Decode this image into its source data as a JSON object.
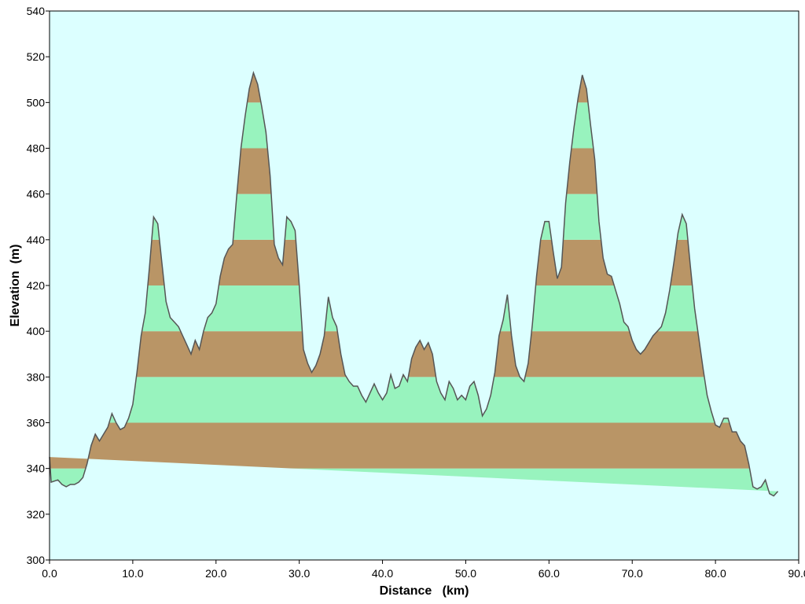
{
  "chart_data": {
    "type": "area",
    "xlabel": "Distance   (km)",
    "ylabel": "Elevation  (m)",
    "xlim": [
      0,
      90
    ],
    "ylim": [
      300,
      540
    ],
    "xticks": [
      0,
      10,
      20,
      30,
      40,
      50,
      60,
      70,
      80,
      90
    ],
    "xtick_labels": [
      "0.0",
      "10.0",
      "20.0",
      "30.0",
      "40.0",
      "50.0",
      "60.0",
      "70.0",
      "80.0",
      "90.0"
    ],
    "yticks": [
      300,
      320,
      340,
      360,
      380,
      400,
      420,
      440,
      460,
      480,
      500,
      520,
      540
    ],
    "ytick_labels": [
      "300",
      "320",
      "340",
      "360",
      "380",
      "400",
      "420",
      "440",
      "460",
      "480",
      "500",
      "520",
      "540"
    ],
    "band_interval": 20,
    "colors": {
      "background": "#dcffff",
      "band_brown": "#b99566",
      "band_green": "#98f3be",
      "profile_line": "#555555",
      "frame": "#000000"
    },
    "x": [
      0,
      0.2,
      1,
      1.5,
      2,
      2.5,
      3,
      3.5,
      4,
      4.5,
      5,
      5.5,
      6,
      6.5,
      7,
      7.5,
      8,
      8.5,
      9,
      9.5,
      10,
      10.5,
      11,
      11.5,
      12,
      12.5,
      13,
      13.5,
      14,
      14.5,
      15,
      15.5,
      16,
      16.5,
      17,
      17.5,
      18,
      18.5,
      19,
      19.5,
      20,
      20.5,
      21,
      21.5,
      22,
      22.5,
      23,
      23.5,
      24,
      24.5,
      25,
      25.5,
      26,
      26.5,
      27,
      27.5,
      28,
      28.5,
      29,
      29.5,
      30,
      30.5,
      31,
      31.5,
      32,
      32.5,
      33,
      33.5,
      34,
      34.5,
      35,
      35.5,
      36,
      36.5,
      37,
      37.5,
      38,
      38.5,
      39,
      39.5,
      40,
      40.5,
      41,
      41.5,
      42,
      42.5,
      43,
      43.5,
      44,
      44.5,
      45,
      45.5,
      46,
      46.5,
      47,
      47.5,
      48,
      48.5,
      49,
      49.5,
      50,
      50.5,
      51,
      51.5,
      52,
      52.5,
      53,
      53.5,
      54,
      54.5,
      55,
      55.5,
      56,
      56.5,
      57,
      57.5,
      58,
      58.5,
      59,
      59.5,
      60,
      60.5,
      61,
      61.5,
      62,
      62.5,
      63,
      63.5,
      64,
      64.5,
      65,
      65.5,
      66,
      66.5,
      67,
      67.5,
      68,
      68.5,
      69,
      69.5,
      70,
      70.5,
      71,
      71.5,
      72,
      72.5,
      73,
      73.5,
      74,
      74.5,
      75,
      75.5,
      76,
      76.5,
      77,
      77.5,
      78,
      78.5,
      79,
      79.5,
      80,
      80.5,
      81,
      81.5,
      82,
      82.5,
      83,
      83.5,
      84,
      84.5,
      85,
      85.5,
      86,
      86.5,
      87,
      87.5,
      88,
      88.5,
      89,
      89.5,
      90,
      90.5
    ],
    "y": [
      345,
      334,
      335,
      333,
      332,
      333,
      333,
      334,
      336,
      342,
      350,
      355,
      352,
      355,
      358,
      364,
      360,
      357,
      358,
      362,
      368,
      382,
      398,
      408,
      428,
      450,
      447,
      430,
      413,
      406,
      404,
      402,
      398,
      394,
      390,
      396,
      392,
      400,
      406,
      408,
      412,
      424,
      432,
      436,
      438,
      460,
      480,
      494,
      506,
      513,
      508,
      498,
      487,
      468,
      438,
      432,
      429,
      450,
      448,
      444,
      420,
      392,
      386,
      382,
      385,
      390,
      398,
      415,
      406,
      402,
      390,
      381,
      378,
      376,
      376,
      372,
      369,
      373,
      377,
      373,
      370,
      373,
      381,
      375,
      376,
      381,
      378,
      388,
      393,
      396,
      392,
      395,
      390,
      378,
      373,
      370,
      378,
      375,
      370,
      372,
      370,
      376,
      378,
      372,
      363,
      366,
      372,
      382,
      398,
      405,
      416,
      398,
      385,
      380,
      378,
      386,
      403,
      424,
      440,
      448,
      448,
      435,
      423,
      428,
      456,
      474,
      489,
      502,
      512,
      506,
      490,
      475,
      448,
      432,
      425,
      424,
      418,
      412,
      404,
      402,
      396,
      392,
      390,
      392,
      395,
      398,
      400,
      402,
      408,
      418,
      430,
      443,
      451,
      447,
      428,
      410,
      397,
      384,
      372,
      365,
      359,
      358,
      362,
      362,
      356,
      356,
      352,
      350,
      342,
      332,
      331,
      332,
      335,
      329,
      328,
      330
    ]
  }
}
